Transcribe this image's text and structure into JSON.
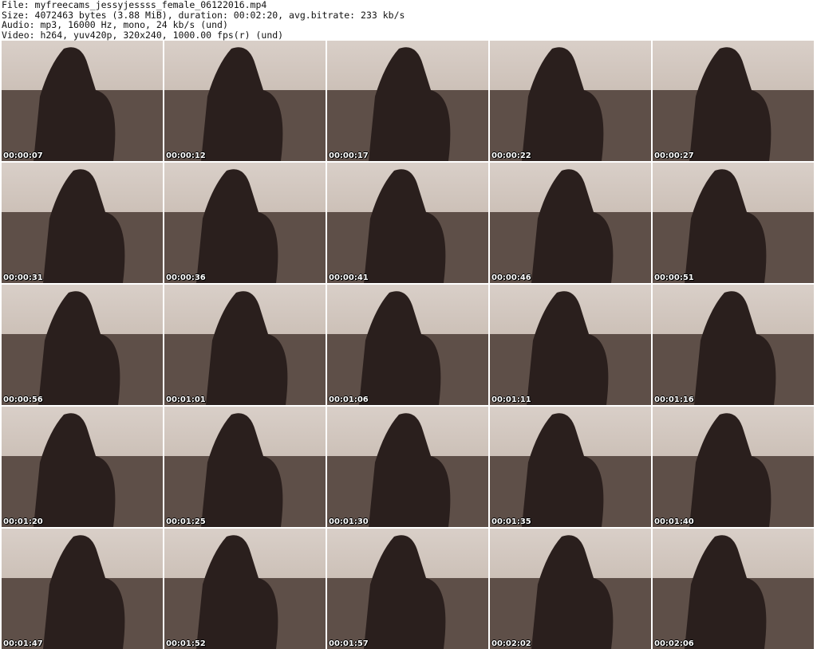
{
  "header": {
    "file_line": "File: myfreecams_jessyjessss_female_06122016.mp4",
    "size_line": "Size: 4072463 bytes (3.88 MiB), duration: 00:02:20, avg.bitrate: 233 kb/s",
    "audio_line": "Audio: mp3, 16000 Hz, mono, 24 kb/s (und)",
    "video_line": "Video: h264, yuv420p, 320x240, 1000.00 fps(r) (und)"
  },
  "thumbnails": [
    {
      "timestamp": "00:00:07"
    },
    {
      "timestamp": "00:00:12"
    },
    {
      "timestamp": "00:00:17"
    },
    {
      "timestamp": "00:00:22"
    },
    {
      "timestamp": "00:00:27"
    },
    {
      "timestamp": "00:00:31"
    },
    {
      "timestamp": "00:00:36"
    },
    {
      "timestamp": "00:00:41"
    },
    {
      "timestamp": "00:00:46"
    },
    {
      "timestamp": "00:00:51"
    },
    {
      "timestamp": "00:00:56"
    },
    {
      "timestamp": "00:01:01"
    },
    {
      "timestamp": "00:01:06"
    },
    {
      "timestamp": "00:01:11"
    },
    {
      "timestamp": "00:01:16"
    },
    {
      "timestamp": "00:01:20"
    },
    {
      "timestamp": "00:01:25"
    },
    {
      "timestamp": "00:01:30"
    },
    {
      "timestamp": "00:01:35"
    },
    {
      "timestamp": "00:01:40"
    },
    {
      "timestamp": "00:01:47"
    },
    {
      "timestamp": "00:01:52"
    },
    {
      "timestamp": "00:01:57"
    },
    {
      "timestamp": "00:02:02"
    },
    {
      "timestamp": "00:02:06"
    }
  ]
}
